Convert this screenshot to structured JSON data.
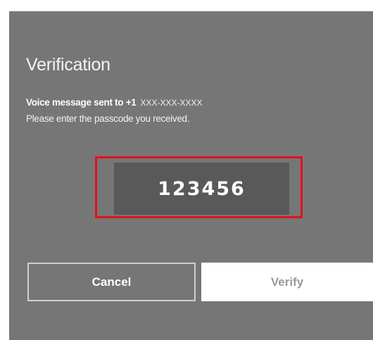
{
  "dialog": {
    "title": "Verification",
    "message_prefix": "Voice message sent to +1",
    "masked_number": "XXX-XXX-XXXX",
    "instruction": "Please enter the passcode you received.",
    "passcode_value": "123456",
    "cancel_label": "Cancel",
    "verify_label": "Verify"
  },
  "colors": {
    "dialog_background": "#767676",
    "input_background": "#595959",
    "highlight_border": "#e3101c",
    "verify_button_background": "#ffffff",
    "verify_button_text": "#9a9a9a"
  }
}
